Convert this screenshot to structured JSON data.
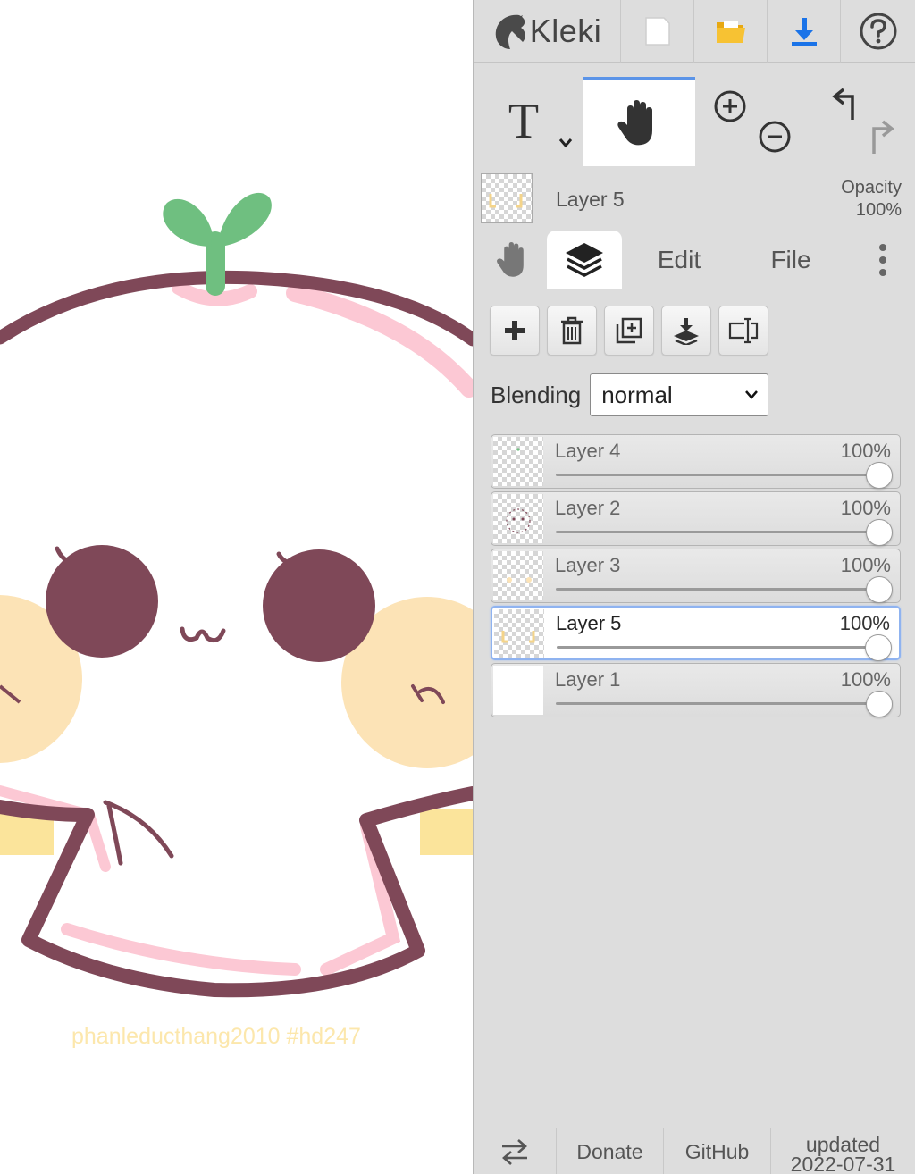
{
  "canvas": {
    "watermark": "phanleducthang2010 #hd247",
    "colors": {
      "outline": "#7f4858",
      "pink": "#fcc8d4",
      "cheek": "#fce3b6",
      "leaf": "#6fbf80",
      "eye": "#7f4858",
      "band": "#fbe49b"
    }
  },
  "app": {
    "name": "Kleki"
  },
  "topbar": {
    "new_icon": "new-image-icon",
    "open_icon": "open-folder-icon",
    "save_icon": "download-icon",
    "help_icon": "help-icon"
  },
  "tools": {
    "text_tool": "T",
    "hand_tool": "hand-icon",
    "zoom_in": "zoom-in-icon",
    "zoom_out": "zoom-out-icon",
    "undo": "undo-icon",
    "redo": "redo-icon"
  },
  "current_layer": {
    "name": "Layer 5",
    "opacity_label": "Opacity",
    "opacity_value": "100%"
  },
  "tabs": {
    "hand": "hand-icon",
    "layers": "layers-icon",
    "edit": "Edit",
    "file": "File",
    "more": "more-icon"
  },
  "layer_actions": [
    "add-layer",
    "delete-layer",
    "duplicate-layer",
    "merge-down",
    "rename-layer"
  ],
  "blending": {
    "label": "Blending",
    "value": "normal"
  },
  "layers": [
    {
      "name": "Layer 4",
      "opacity": "100%",
      "opacity_value": 1.0,
      "active": false
    },
    {
      "name": "Layer 2",
      "opacity": "100%",
      "opacity_value": 1.0,
      "active": false
    },
    {
      "name": "Layer 3",
      "opacity": "100%",
      "opacity_value": 1.0,
      "active": false
    },
    {
      "name": "Layer 5",
      "opacity": "100%",
      "opacity_value": 1.0,
      "active": true
    },
    {
      "name": "Layer 1",
      "opacity": "100%",
      "opacity_value": 1.0,
      "active": false
    }
  ],
  "footer": {
    "swap_icon": "swap-icon",
    "donate": "Donate",
    "github": "GitHub",
    "updated_label": "updated",
    "updated_date": "2022-07-31"
  }
}
